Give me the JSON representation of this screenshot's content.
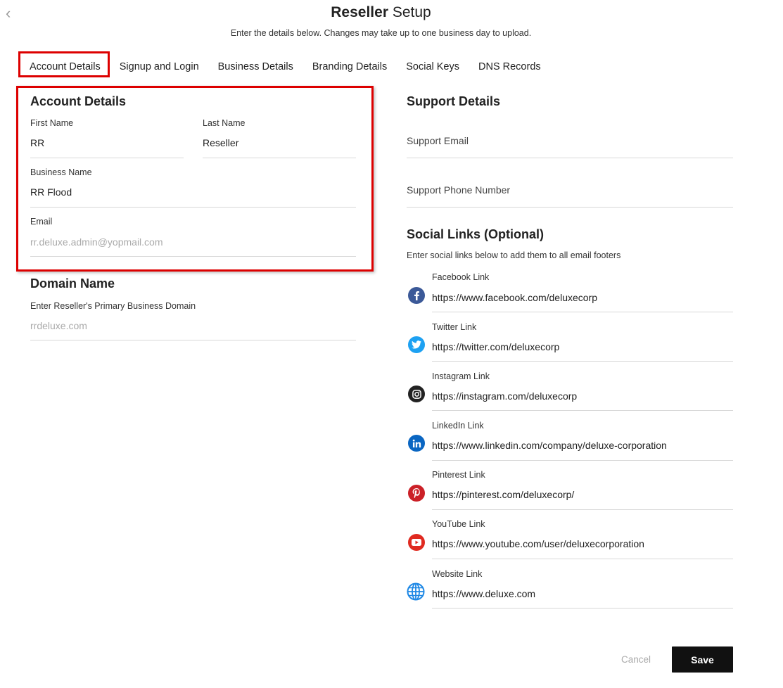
{
  "header": {
    "back_icon": "chevron-left-icon",
    "title_bold": "Reseller",
    "title_rest": " Setup",
    "subtitle": "Enter the details below. Changes may take up to one business day to upload."
  },
  "tabs": [
    {
      "label": "Account Details",
      "active": true
    },
    {
      "label": "Signup and Login"
    },
    {
      "label": "Business Details"
    },
    {
      "label": "Branding Details"
    },
    {
      "label": "Social Keys"
    },
    {
      "label": "DNS Records"
    }
  ],
  "account": {
    "heading": "Account Details",
    "first_name_label": "First Name",
    "first_name_value": "RR",
    "last_name_label": "Last Name",
    "last_name_value": "Reseller",
    "business_name_label": "Business Name",
    "business_name_value": "RR Flood",
    "email_label": "Email",
    "email_value": "rr.deluxe.admin@yopmail.com"
  },
  "domain": {
    "heading": "Domain Name",
    "label": "Enter Reseller's Primary Business Domain",
    "value": "rrdeluxe.com"
  },
  "support": {
    "heading": "Support Details",
    "email_placeholder": "Support Email",
    "phone_placeholder": "Support Phone Number"
  },
  "social": {
    "heading": "Social Links (Optional)",
    "description": "Enter social links below to add them to all email footers",
    "links": [
      {
        "label": "Facebook Link",
        "value": "https://www.facebook.com/deluxecorp",
        "icon": "facebook-icon",
        "color": "#3b5998"
      },
      {
        "label": "Twitter Link",
        "value": "https://twitter.com/deluxecorp",
        "icon": "twitter-icon",
        "color": "#1da1f2"
      },
      {
        "label": "Instagram Link",
        "value": "https://instagram.com/deluxecorp",
        "icon": "instagram-icon",
        "color": "#222222"
      },
      {
        "label": "LinkedIn Link",
        "value": "https://www.linkedin.com/company/deluxe-corporation",
        "icon": "linkedin-icon",
        "color": "#0a66c2"
      },
      {
        "label": "Pinterest Link",
        "value": "https://pinterest.com/deluxecorp/",
        "icon": "pinterest-icon",
        "color": "#cb2027"
      },
      {
        "label": "YouTube Link",
        "value": "https://www.youtube.com/user/deluxecorporation",
        "icon": "youtube-icon",
        "color": "#e02a20"
      },
      {
        "label": "Website Link",
        "value": "https://www.deluxe.com",
        "icon": "globe-icon",
        "color": "#1e88e5"
      }
    ]
  },
  "footer": {
    "cancel_label": "Cancel",
    "save_label": "Save"
  },
  "colors": {
    "highlight": "#dd0000",
    "save_bg": "#111111"
  }
}
